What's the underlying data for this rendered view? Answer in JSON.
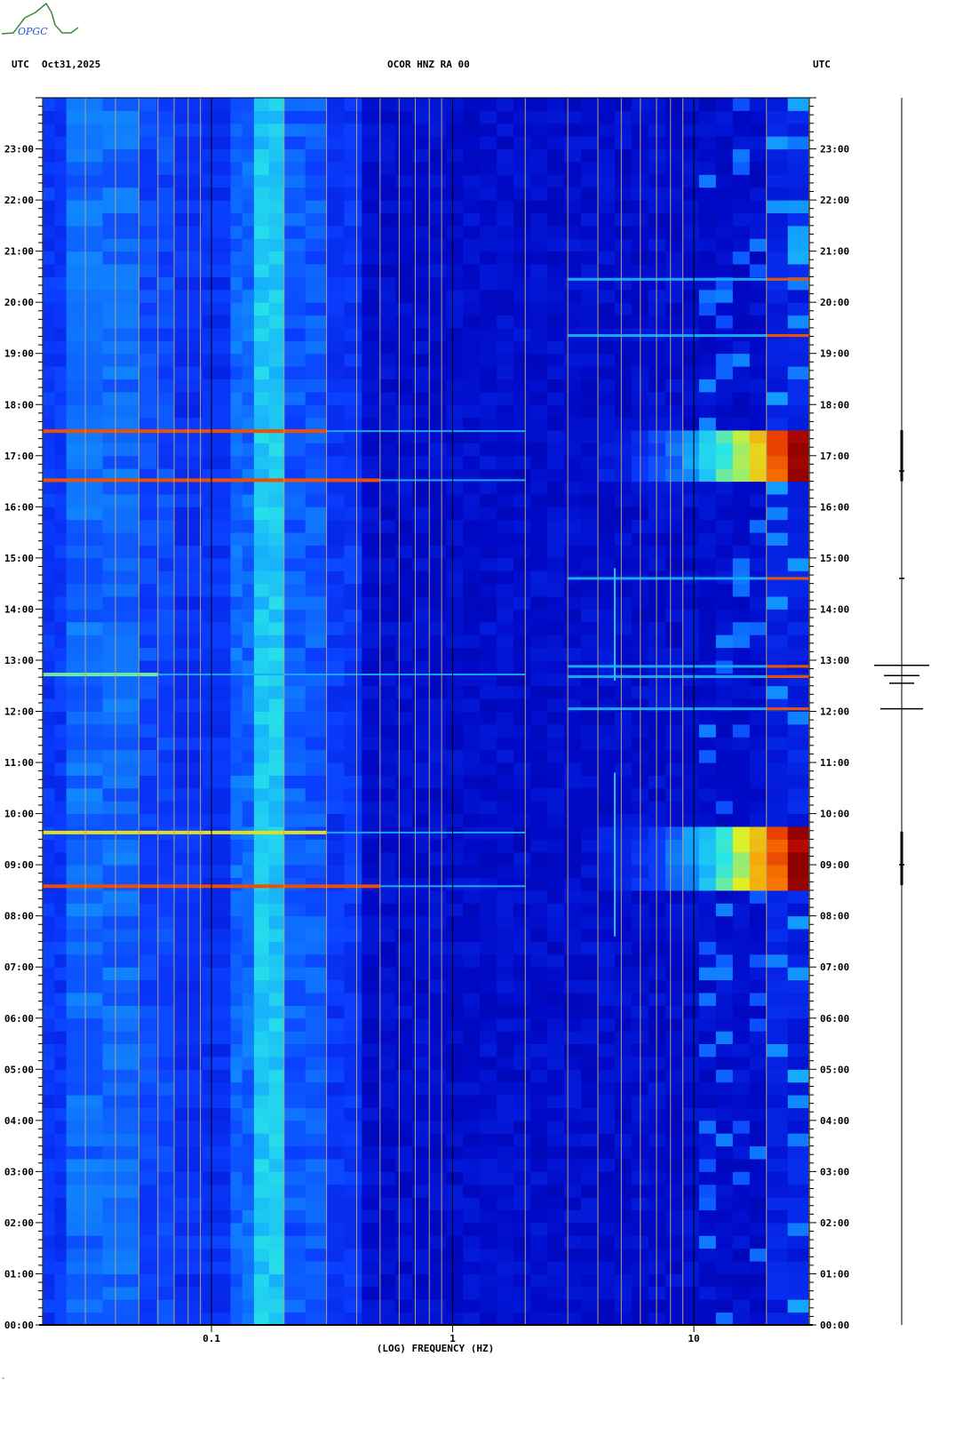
{
  "header": {
    "logo_text": "OPGC",
    "left_tz": "UTC",
    "date": "Oct31,2025",
    "station": "OCOR HNZ RA 00",
    "right_tz": "UTC"
  },
  "footer_mark": "‴",
  "chart_data": {
    "type": "heatmap",
    "title": "OCOR HNZ RA 00",
    "xlabel": "(LOG) FREQUENCY (HZ)",
    "ylabel": "UTC",
    "x_scale": "log",
    "xlim": [
      0.02,
      30
    ],
    "ylim_hours": [
      0,
      24
    ],
    "x_ticks": [
      {
        "value": 0.1,
        "label": "0.1"
      },
      {
        "value": 1,
        "label": "1"
      },
      {
        "value": 10,
        "label": "10"
      }
    ],
    "y_ticks": [
      {
        "value": 0,
        "label": "00:00"
      },
      {
        "value": 1,
        "label": "01:00"
      },
      {
        "value": 2,
        "label": "02:00"
      },
      {
        "value": 3,
        "label": "03:00"
      },
      {
        "value": 4,
        "label": "04:00"
      },
      {
        "value": 5,
        "label": "05:00"
      },
      {
        "value": 6,
        "label": "06:00"
      },
      {
        "value": 7,
        "label": "07:00"
      },
      {
        "value": 8,
        "label": "08:00"
      },
      {
        "value": 9,
        "label": "09:00"
      },
      {
        "value": 10,
        "label": "10:00"
      },
      {
        "value": 11,
        "label": "11:00"
      },
      {
        "value": 12,
        "label": "12:00"
      },
      {
        "value": 13,
        "label": "13:00"
      },
      {
        "value": 14,
        "label": "14:00"
      },
      {
        "value": 15,
        "label": "15:00"
      },
      {
        "value": 16,
        "label": "16:00"
      },
      {
        "value": 17,
        "label": "17:00"
      },
      {
        "value": 18,
        "label": "18:00"
      },
      {
        "value": 19,
        "label": "19:00"
      },
      {
        "value": 20,
        "label": "20:00"
      },
      {
        "value": 21,
        "label": "21:00"
      },
      {
        "value": 22,
        "label": "22:00"
      },
      {
        "value": 23,
        "label": "23:00"
      }
    ],
    "colormap": "jet",
    "spectral_profile": [
      {
        "f_min": 0.02,
        "f_max": 0.025,
        "level": 0.28
      },
      {
        "f_min": 0.025,
        "f_max": 0.05,
        "level": 0.36
      },
      {
        "f_min": 0.05,
        "f_max": 0.07,
        "level": 0.31
      },
      {
        "f_min": 0.07,
        "f_max": 0.12,
        "level": 0.27
      },
      {
        "f_min": 0.12,
        "f_max": 0.15,
        "level": 0.36
      },
      {
        "f_min": 0.15,
        "f_max": 0.2,
        "level": 0.5
      },
      {
        "f_min": 0.2,
        "f_max": 0.3,
        "level": 0.34
      },
      {
        "f_min": 0.3,
        "f_max": 0.42,
        "level": 0.28
      },
      {
        "f_min": 0.42,
        "f_max": 20,
        "level": 0.16
      },
      {
        "f_min": 20,
        "f_max": 30,
        "level": 0.22
      }
    ],
    "events": [
      {
        "start": 16.5,
        "end": 17.5,
        "f_min": 4,
        "f_max": 30,
        "level_low": 0.2,
        "level_high": 1.0
      },
      {
        "start": 8.6,
        "end": 9.65,
        "f_min": 4,
        "f_max": 30,
        "level_low": 0.2,
        "level_high": 1.0
      }
    ],
    "horizontal_lines": [
      {
        "time": 17.48,
        "level": 0.85,
        "f_max": 0.3
      },
      {
        "time": 16.52,
        "level": 0.85,
        "f_max": 0.5
      },
      {
        "time": 9.63,
        "level": 0.7,
        "f_max": 0.3
      },
      {
        "time": 8.58,
        "level": 0.85,
        "f_max": 0.5
      },
      {
        "time": 12.72,
        "level": 0.6,
        "f_max": 0.06
      }
    ],
    "high_freq_bursts": [
      12.05,
      12.68,
      12.88,
      14.6,
      20.45,
      19.35
    ],
    "vertical_lines": [
      {
        "freq": 4.7,
        "start": 12.6,
        "end": 14.8
      },
      {
        "freq": 4.7,
        "start": 7.6,
        "end": 10.8
      }
    ],
    "trace_spikes": [
      12.9,
      12.05,
      12.55,
      12.7,
      16.7,
      9.0,
      14.6
    ]
  }
}
